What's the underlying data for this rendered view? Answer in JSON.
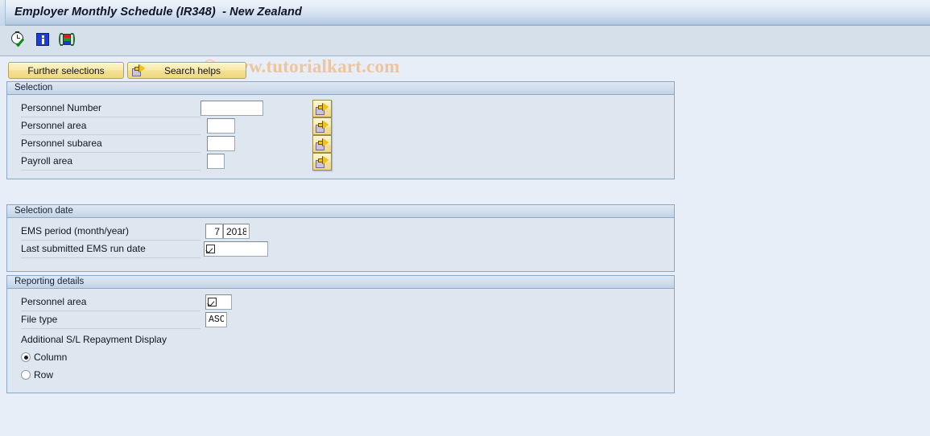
{
  "window": {
    "title": "Employer Monthly Schedule (IR348)  - New Zealand"
  },
  "watermark": {
    "text": "© www.tutorialkart.com"
  },
  "toolbar": {
    "icons": [
      {
        "name": "execute-clock-icon",
        "label": "Execute"
      },
      {
        "name": "info-icon",
        "label": "Information"
      },
      {
        "name": "variant-icon",
        "label": "Get Variant"
      }
    ]
  },
  "action_buttons": {
    "further_selections": "Further selections",
    "search_helps": "Search helps"
  },
  "panels": {
    "selection": {
      "title": "Selection",
      "fields": [
        {
          "label": "Personnel Number",
          "value": "",
          "width": 78,
          "select_button": true
        },
        {
          "label": "Personnel area",
          "value": "",
          "width": 35,
          "select_button": true
        },
        {
          "label": "Personnel subarea",
          "value": "",
          "width": 35,
          "select_button": true
        },
        {
          "label": "Payroll area",
          "value": "",
          "width": 22,
          "select_button": true
        }
      ]
    },
    "selection_date": {
      "title": "Selection date",
      "ems_period": {
        "label": "EMS period (month/year)",
        "month": "7",
        "year": "2018"
      },
      "last_run": {
        "label": "Last submitted EMS run date",
        "value": ""
      }
    },
    "reporting_details": {
      "title": "Reporting details",
      "personnel_area": {
        "label": "Personnel area",
        "value": ""
      },
      "file_type": {
        "label": "File type",
        "value": "ASC"
      },
      "additional_display": {
        "label": "Additional S/L Repayment Display",
        "options": [
          {
            "label": "Column",
            "selected": true
          },
          {
            "label": "Row",
            "selected": false
          }
        ]
      }
    }
  },
  "colors": {
    "title_bar_top": "#eef3f9",
    "title_bar_bottom": "#9ab5d4",
    "toolbar_bg": "#d6e0ea",
    "page_bg": "#e8eef7",
    "panel_bg": "#dee7f0",
    "panel_border": "#8ba7c4",
    "button_yellow": "#f5e6a4",
    "watermark": "#eec49c"
  }
}
